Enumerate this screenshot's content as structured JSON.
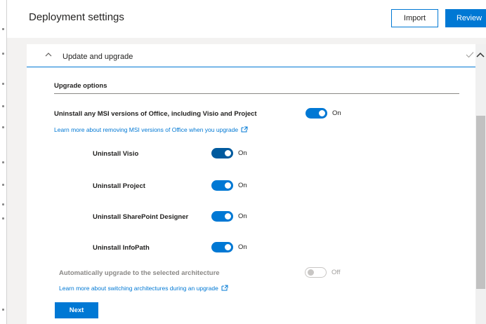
{
  "header": {
    "title": "Deployment settings",
    "import_label": "Import",
    "review_label": "Review"
  },
  "section": {
    "title": "Update and upgrade",
    "subheading": "Upgrade options"
  },
  "uninstall_msi": {
    "label": "Uninstall any MSI versions of Office, including Visio and Project",
    "state": "On",
    "link": "Learn more about removing MSI versions of Office when you upgrade"
  },
  "options": [
    {
      "label": "Uninstall Visio",
      "state": "On"
    },
    {
      "label": "Uninstall Project",
      "state": "On"
    },
    {
      "label": "Uninstall SharePoint Designer",
      "state": "On"
    },
    {
      "label": "Uninstall InfoPath",
      "state": "On"
    }
  ],
  "architecture": {
    "label": "Automatically upgrade to the selected architecture",
    "state": "Off",
    "link": "Learn more about switching architectures during an upgrade"
  },
  "next_label": "Next",
  "colors": {
    "accent": "#0078d4",
    "toggle_focused": "#005a9e",
    "disabled_text": "#8a8886",
    "background": "#f3f2f1"
  },
  "icons": [
    "chevron-up-icon",
    "checkmark-icon",
    "external-link-icon",
    "scroll-up-arrow-icon"
  ]
}
